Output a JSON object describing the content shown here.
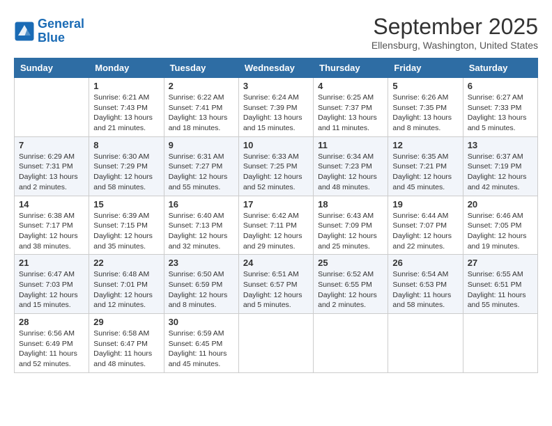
{
  "header": {
    "logo_line1": "General",
    "logo_line2": "Blue",
    "month": "September 2025",
    "location": "Ellensburg, Washington, United States"
  },
  "days_of_week": [
    "Sunday",
    "Monday",
    "Tuesday",
    "Wednesday",
    "Thursday",
    "Friday",
    "Saturday"
  ],
  "weeks": [
    [
      {
        "num": "",
        "info": ""
      },
      {
        "num": "1",
        "info": "Sunrise: 6:21 AM\nSunset: 7:43 PM\nDaylight: 13 hours\nand 21 minutes."
      },
      {
        "num": "2",
        "info": "Sunrise: 6:22 AM\nSunset: 7:41 PM\nDaylight: 13 hours\nand 18 minutes."
      },
      {
        "num": "3",
        "info": "Sunrise: 6:24 AM\nSunset: 7:39 PM\nDaylight: 13 hours\nand 15 minutes."
      },
      {
        "num": "4",
        "info": "Sunrise: 6:25 AM\nSunset: 7:37 PM\nDaylight: 13 hours\nand 11 minutes."
      },
      {
        "num": "5",
        "info": "Sunrise: 6:26 AM\nSunset: 7:35 PM\nDaylight: 13 hours\nand 8 minutes."
      },
      {
        "num": "6",
        "info": "Sunrise: 6:27 AM\nSunset: 7:33 PM\nDaylight: 13 hours\nand 5 minutes."
      }
    ],
    [
      {
        "num": "7",
        "info": "Sunrise: 6:29 AM\nSunset: 7:31 PM\nDaylight: 13 hours\nand 2 minutes."
      },
      {
        "num": "8",
        "info": "Sunrise: 6:30 AM\nSunset: 7:29 PM\nDaylight: 12 hours\nand 58 minutes."
      },
      {
        "num": "9",
        "info": "Sunrise: 6:31 AM\nSunset: 7:27 PM\nDaylight: 12 hours\nand 55 minutes."
      },
      {
        "num": "10",
        "info": "Sunrise: 6:33 AM\nSunset: 7:25 PM\nDaylight: 12 hours\nand 52 minutes."
      },
      {
        "num": "11",
        "info": "Sunrise: 6:34 AM\nSunset: 7:23 PM\nDaylight: 12 hours\nand 48 minutes."
      },
      {
        "num": "12",
        "info": "Sunrise: 6:35 AM\nSunset: 7:21 PM\nDaylight: 12 hours\nand 45 minutes."
      },
      {
        "num": "13",
        "info": "Sunrise: 6:37 AM\nSunset: 7:19 PM\nDaylight: 12 hours\nand 42 minutes."
      }
    ],
    [
      {
        "num": "14",
        "info": "Sunrise: 6:38 AM\nSunset: 7:17 PM\nDaylight: 12 hours\nand 38 minutes."
      },
      {
        "num": "15",
        "info": "Sunrise: 6:39 AM\nSunset: 7:15 PM\nDaylight: 12 hours\nand 35 minutes."
      },
      {
        "num": "16",
        "info": "Sunrise: 6:40 AM\nSunset: 7:13 PM\nDaylight: 12 hours\nand 32 minutes."
      },
      {
        "num": "17",
        "info": "Sunrise: 6:42 AM\nSunset: 7:11 PM\nDaylight: 12 hours\nand 29 minutes."
      },
      {
        "num": "18",
        "info": "Sunrise: 6:43 AM\nSunset: 7:09 PM\nDaylight: 12 hours\nand 25 minutes."
      },
      {
        "num": "19",
        "info": "Sunrise: 6:44 AM\nSunset: 7:07 PM\nDaylight: 12 hours\nand 22 minutes."
      },
      {
        "num": "20",
        "info": "Sunrise: 6:46 AM\nSunset: 7:05 PM\nDaylight: 12 hours\nand 19 minutes."
      }
    ],
    [
      {
        "num": "21",
        "info": "Sunrise: 6:47 AM\nSunset: 7:03 PM\nDaylight: 12 hours\nand 15 minutes."
      },
      {
        "num": "22",
        "info": "Sunrise: 6:48 AM\nSunset: 7:01 PM\nDaylight: 12 hours\nand 12 minutes."
      },
      {
        "num": "23",
        "info": "Sunrise: 6:50 AM\nSunset: 6:59 PM\nDaylight: 12 hours\nand 8 minutes."
      },
      {
        "num": "24",
        "info": "Sunrise: 6:51 AM\nSunset: 6:57 PM\nDaylight: 12 hours\nand 5 minutes."
      },
      {
        "num": "25",
        "info": "Sunrise: 6:52 AM\nSunset: 6:55 PM\nDaylight: 12 hours\nand 2 minutes."
      },
      {
        "num": "26",
        "info": "Sunrise: 6:54 AM\nSunset: 6:53 PM\nDaylight: 11 hours\nand 58 minutes."
      },
      {
        "num": "27",
        "info": "Sunrise: 6:55 AM\nSunset: 6:51 PM\nDaylight: 11 hours\nand 55 minutes."
      }
    ],
    [
      {
        "num": "28",
        "info": "Sunrise: 6:56 AM\nSunset: 6:49 PM\nDaylight: 11 hours\nand 52 minutes."
      },
      {
        "num": "29",
        "info": "Sunrise: 6:58 AM\nSunset: 6:47 PM\nDaylight: 11 hours\nand 48 minutes."
      },
      {
        "num": "30",
        "info": "Sunrise: 6:59 AM\nSunset: 6:45 PM\nDaylight: 11 hours\nand 45 minutes."
      },
      {
        "num": "",
        "info": ""
      },
      {
        "num": "",
        "info": ""
      },
      {
        "num": "",
        "info": ""
      },
      {
        "num": "",
        "info": ""
      }
    ]
  ]
}
